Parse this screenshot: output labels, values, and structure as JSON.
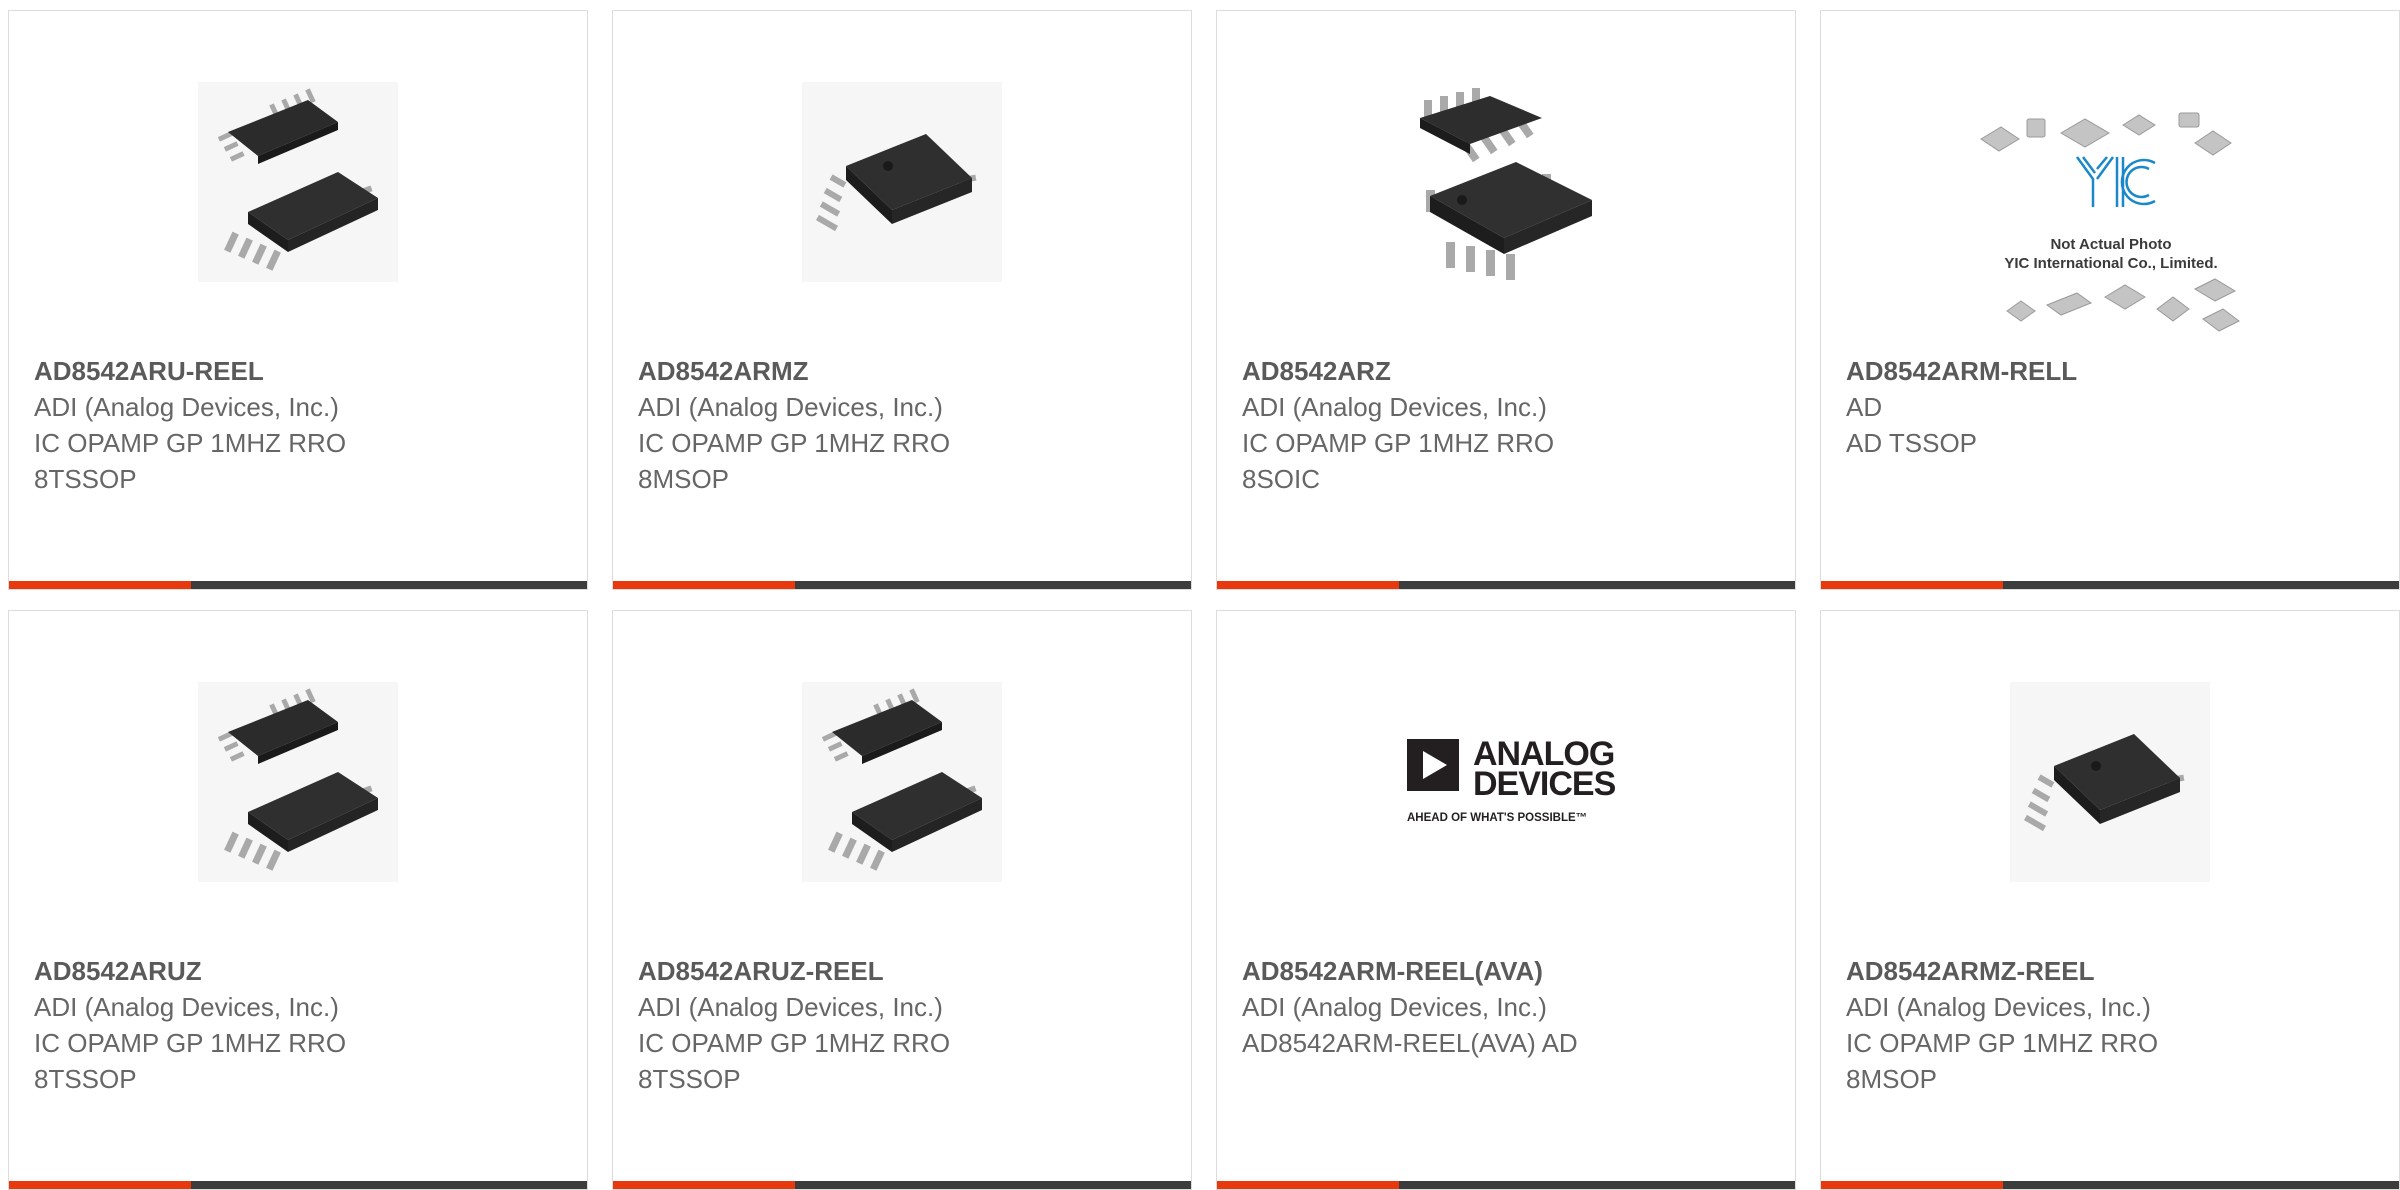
{
  "colors": {
    "accent": "#e8380d",
    "bar": "#3c3c3c",
    "border": "#dcdcdc",
    "text": "#666666"
  },
  "products": [
    {
      "part": "AD8542ARU-REEL",
      "manufacturer": "ADI (Analog Devices, Inc.)",
      "description": "IC OPAMP GP 1MHZ RRO",
      "package": "8TSSOP",
      "image": "tssop-chip-pair-icon"
    },
    {
      "part": "AD8542ARMZ",
      "manufacturer": "ADI (Analog Devices, Inc.)",
      "description": "IC OPAMP GP 1MHZ RRO",
      "package": "8MSOP",
      "image": "msop-chip-icon"
    },
    {
      "part": "AD8542ARZ",
      "manufacturer": "ADI (Analog Devices, Inc.)",
      "description": "IC OPAMP GP 1MHZ RRO",
      "package": "8SOIC",
      "image": "soic-chip-pair-icon"
    },
    {
      "part": "AD8542ARM-RELL",
      "manufacturer": "AD",
      "description": "AD TSSOP",
      "package": "",
      "image": "not-actual-photo-placeholder",
      "placeholder": {
        "logo": "YIC",
        "line1": "Not Actual Photo",
        "line2": "YIC International Co., Limited."
      }
    },
    {
      "part": "AD8542ARUZ",
      "manufacturer": "ADI (Analog Devices, Inc.)",
      "description": "IC OPAMP GP 1MHZ RRO",
      "package": "8TSSOP",
      "image": "tssop-chip-pair-icon"
    },
    {
      "part": "AD8542ARUZ-REEL",
      "manufacturer": "ADI (Analog Devices, Inc.)",
      "description": "IC OPAMP GP 1MHZ RRO",
      "package": "8TSSOP",
      "image": "tssop-chip-pair-icon"
    },
    {
      "part": "AD8542ARM-REEL(AVA)",
      "manufacturer": "ADI (Analog Devices, Inc.)",
      "description": "AD8542ARM-REEL(AVA) AD",
      "package": "",
      "image": "analog-devices-logo",
      "logo": {
        "line1": "ANALOG",
        "line2": "DEVICES",
        "tagline": "AHEAD OF WHAT'S POSSIBLE™"
      }
    },
    {
      "part": "AD8542ARMZ-REEL",
      "manufacturer": "ADI (Analog Devices, Inc.)",
      "description": "IC OPAMP GP 1MHZ RRO",
      "package": "8MSOP",
      "image": "msop-chip-icon"
    }
  ]
}
